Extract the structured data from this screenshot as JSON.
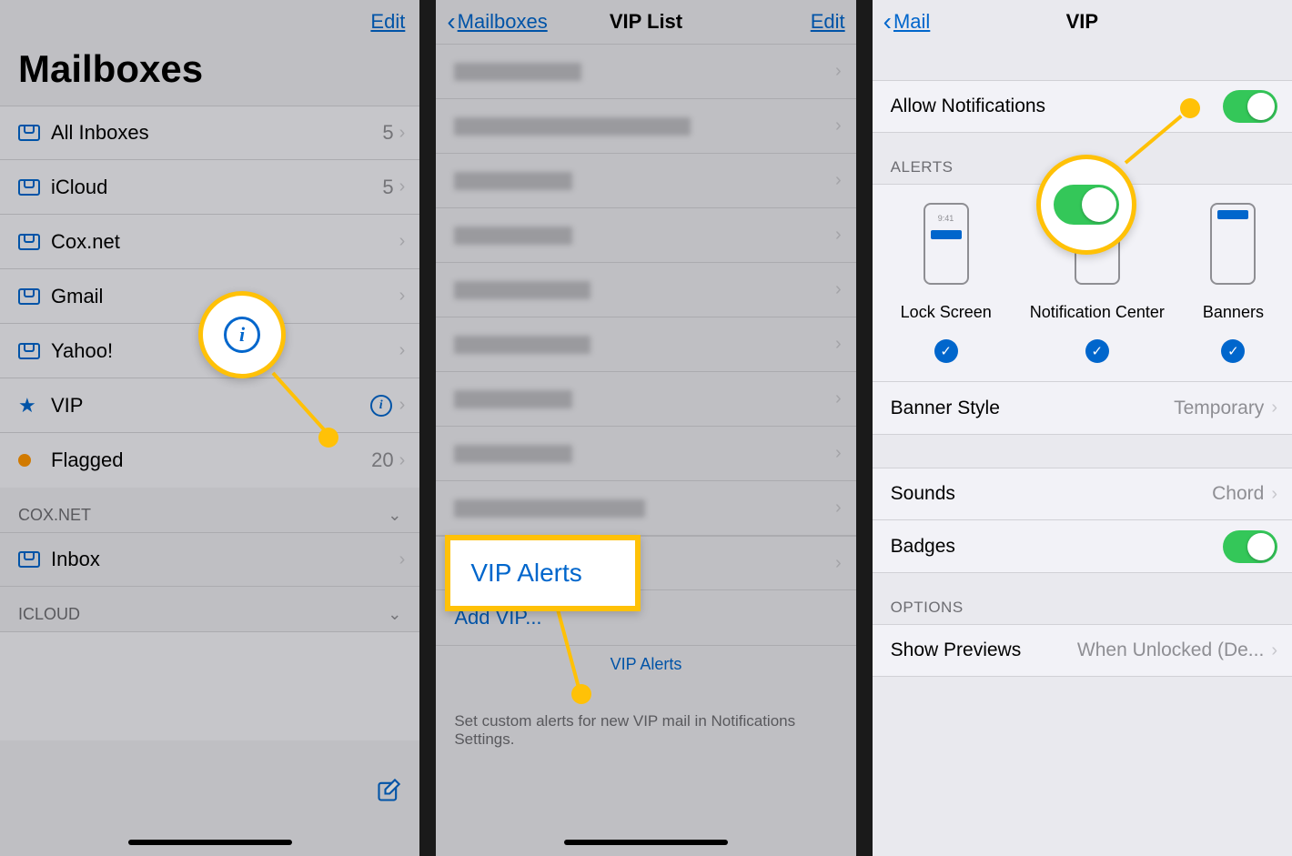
{
  "screen1": {
    "edit": "Edit",
    "title": "Mailboxes",
    "rows": [
      {
        "label": "All Inboxes",
        "count": "5",
        "icon": "tray"
      },
      {
        "label": "iCloud",
        "count": "5",
        "icon": "tray"
      },
      {
        "label": "Cox.net",
        "count": "",
        "icon": "tray"
      },
      {
        "label": "Gmail",
        "count": "",
        "icon": "tray"
      },
      {
        "label": "Yahoo!",
        "count": "",
        "icon": "tray"
      },
      {
        "label": "VIP",
        "count": "",
        "icon": "star",
        "info": true
      },
      {
        "label": "Flagged",
        "count": "20",
        "icon": "dot"
      }
    ],
    "sections": [
      {
        "header": "COX.NET",
        "rows": [
          "Inbox"
        ]
      },
      {
        "header": "ICLOUD",
        "rows": []
      }
    ]
  },
  "screen2": {
    "back": "Mailboxes",
    "title": "VIP List",
    "edit": "Edit",
    "vip_alerts": "VIP Alerts",
    "add_vip": "Add VIP...",
    "footer_link": "VIP Alerts",
    "footer_text": "Set custom alerts for new VIP mail in Notifications Settings.",
    "callout_text": "VIP Alerts"
  },
  "screen3": {
    "back": "Mail",
    "title": "VIP",
    "allow_notifications": "Allow Notifications",
    "alerts_header": "ALERTS",
    "alert_opts": [
      "Lock Screen",
      "Notification Center",
      "Banners"
    ],
    "lock_time": "9:41",
    "banner_style": {
      "label": "Banner Style",
      "value": "Temporary"
    },
    "sounds": {
      "label": "Sounds",
      "value": "Chord"
    },
    "badges": "Badges",
    "options_header": "OPTIONS",
    "show_previews": {
      "label": "Show Previews",
      "value": "When Unlocked (De..."
    }
  }
}
